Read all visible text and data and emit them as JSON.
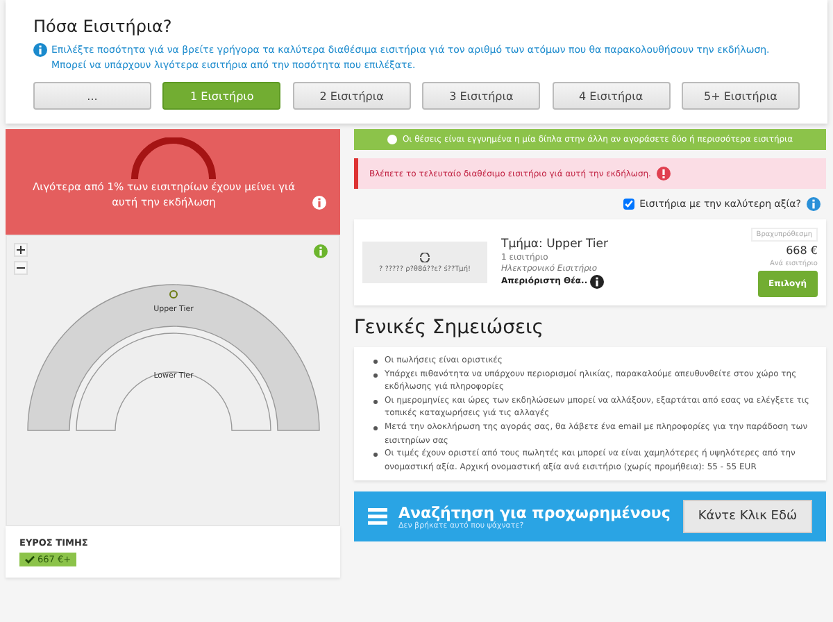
{
  "quantity": {
    "title": "Πόσα Εισιτήρια?",
    "info": "Επιλέξτε ποσότητα γιά να βρείτε γρήγορα τα καλύτερα διαθέσιμα εισιτήρια γιά τον αριθμό των ατόμων που θα παρακολουθήσουν την εκδήλωση. Μπορεί να υπάρχουν λιγότερα εισιτήρια από την ποσότητα που επιλέξατε.",
    "options": [
      {
        "label": "...",
        "selected": false
      },
      {
        "label": "1 Εισιτήριο",
        "selected": true
      },
      {
        "label": "2 Εισιτήρια",
        "selected": false
      },
      {
        "label": "3 Εισιτήρια",
        "selected": false
      },
      {
        "label": "4 Εισιτήρια",
        "selected": false
      },
      {
        "label": "5+ Εισιτήρια",
        "selected": false
      }
    ]
  },
  "availability": {
    "message": "Λιγότερα από 1% των εισιτηρίων έχουν μείνει γιά αυτή την εκδήλωση"
  },
  "map": {
    "sections": [
      {
        "name": "Upper Tier",
        "selected": true
      },
      {
        "name": "Lower Tier",
        "selected": false
      }
    ]
  },
  "price_range": {
    "title": "ΕΥΡΟΣ ΤΙΜΗΣ",
    "tag": "667 €+"
  },
  "notices": [
    {
      "kind": "success",
      "text": "Οι θέσεις είναι εγγυημένα η μία δίπλα στην άλλη αν αγοράσετε δύο ή περισσότερα εισιτήρια"
    },
    {
      "kind": "warning",
      "text": "Βλέπετε το τελευταίο διαθέσιμο εισιτήριο γιά αυτή την εκδήλωση."
    }
  ],
  "best_value": {
    "label": "Εισιτήρια με την καλύτερη αξία?",
    "checked": true
  },
  "listing": {
    "image_text": "? ????? ρ?θ8ά??ε? ś??Τμή!",
    "section": "Τμήμα: Upper Tier",
    "quantity": "1 εισιτήριο",
    "delivery": "Ηλεκτρονικό Εισιτήριο",
    "view": "Απεριόριστη Θέα..",
    "badge": "Βραχυπρόθεσμη",
    "price": "668 €",
    "per": "Ανά εισιτήριο",
    "button": "Επιλογή"
  },
  "notes": {
    "title": "Γενικές Σημειώσεις",
    "items": [
      "Οι πωλήσεις είναι οριστικές",
      "Υπάρχει πιθανότητα να υπάρχουν περιορισμοί ηλικίας, παρακαλούμε απευθυνθείτε στον χώρο της εκδήλωσης γιά πληροφορίες",
      "Οι ημερομηνίες και ώρες των εκδηλώσεων μπορεί να αλλάξουν, εξαρτάται από εσας να ελέγξετε τις τοπικές καταχωρήσεις γιά τις αλλαγές",
      "Μετά την ολοκλήρωση της αγοράς σας, θα λάβετε ένα email με πληροφορίες για την παράδοση των εισιτηρίων σας",
      "Οι τιμές έχουν οριστεί από τους πωλητές και μπορεί να είναι χαμηλότερες ή υψηλότερες από την ονομαστική αξία. Αρχική ονομαστική αξία ανά εισιτήριο (χωρίς προμήθεια): 55 - 55 EUR"
    ]
  },
  "advanced": {
    "title": "Αναζήτηση για προχωρημένους",
    "subtitle": "Δεν βρήκατε αυτό που ψάχνατε?",
    "button": "Κάντε Κλικ Εδώ"
  }
}
